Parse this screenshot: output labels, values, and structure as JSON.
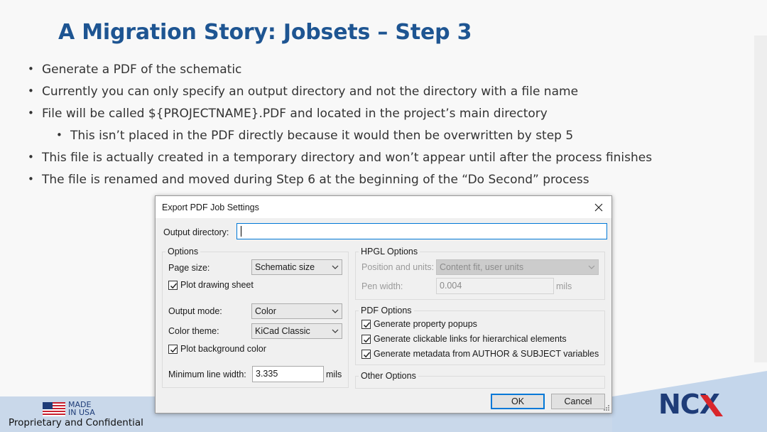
{
  "slide": {
    "title": "A Migration Story: Jobsets – Step 3",
    "bullets": [
      {
        "text": "Generate a PDF of the schematic",
        "level": 1
      },
      {
        "text": "Currently you can only specify an output directory and not the directory with a file name",
        "level": 1
      },
      {
        "text": "File will be called ${PROJECTNAME}.PDF and located in the project’s main directory",
        "level": 1
      },
      {
        "text": "This isn’t placed in the PDF directly because it would then be overwritten by step 5",
        "level": 2
      },
      {
        "text": "This file is actually created in a temporary directory and won’t appear until after the process finishes",
        "level": 1
      },
      {
        "text": "The file is renamed and moved during Step 6 at the beginning of the “Do Second” process",
        "level": 1
      }
    ],
    "bullet_glyph": "•",
    "title_color": "#1e5592"
  },
  "footer": {
    "made_in_usa": "MADE\nIN USA",
    "confidential": "Proprietary and Confidential",
    "logo": "NCX",
    "logo_colors": {
      "primary": "#1e3c78",
      "accent": "#d9262b"
    }
  },
  "dialog": {
    "title": "Export PDF Job Settings",
    "close_icon": "close-icon",
    "output_directory": {
      "label": "Output directory:",
      "value": ""
    },
    "options": {
      "group_label": "Options",
      "page_size": {
        "label": "Page size:",
        "value": "Schematic size"
      },
      "plot_drawing_sheet": {
        "label": "Plot drawing sheet",
        "checked": true
      },
      "output_mode": {
        "label": "Output mode:",
        "value": "Color"
      },
      "color_theme": {
        "label": "Color theme:",
        "value": "KiCad Classic"
      },
      "plot_background_color": {
        "label": "Plot background color",
        "checked": true
      },
      "min_line_width": {
        "label": "Minimum line width:",
        "value": "3.335",
        "unit": "mils"
      }
    },
    "hpgl_options": {
      "group_label": "HPGL Options",
      "position_units": {
        "label": "Position and units:",
        "value": "Content fit, user units",
        "enabled": false
      },
      "pen_width": {
        "label": "Pen width:",
        "value": "0.004",
        "unit": "mils",
        "enabled": false
      }
    },
    "pdf_options": {
      "group_label": "PDF Options",
      "property_popups": {
        "label": "Generate property popups",
        "checked": true
      },
      "clickable_links": {
        "label": "Generate clickable links for hierarchical elements",
        "checked": true
      },
      "metadata": {
        "label": "Generate metadata from AUTHOR & SUBJECT variables",
        "checked": true
      }
    },
    "other_options": {
      "group_label": "Other Options"
    },
    "buttons": {
      "ok": "OK",
      "cancel": "Cancel"
    },
    "accent_color": "#0078d7"
  }
}
